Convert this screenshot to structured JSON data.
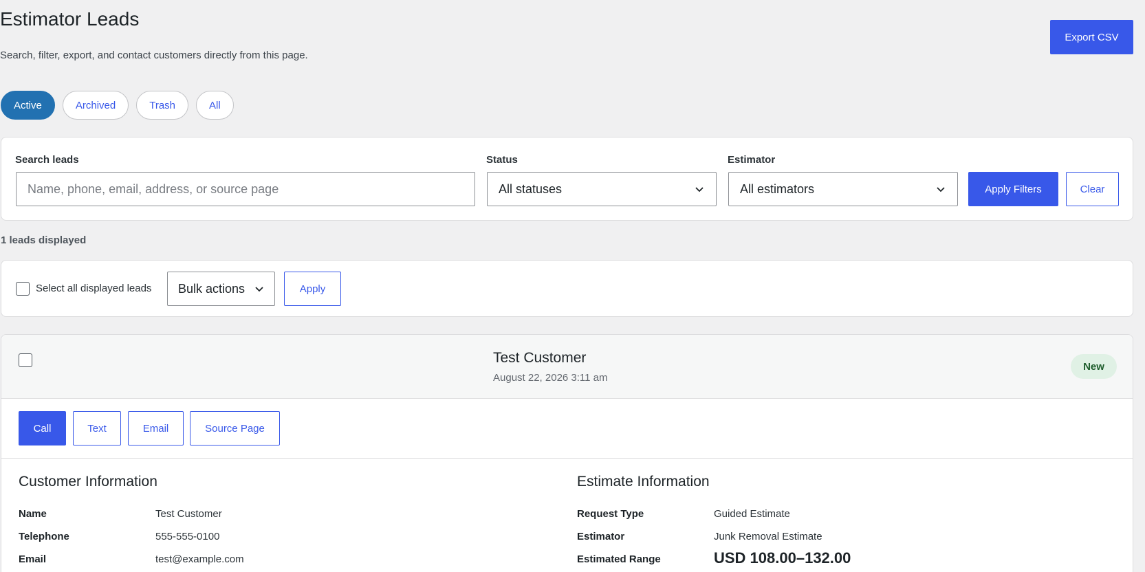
{
  "header": {
    "title": "Estimator Leads",
    "subtitle": "Search, filter, export, and contact customers directly from this page.",
    "export_label": "Export CSV"
  },
  "tabs": [
    {
      "label": "Active",
      "active": true
    },
    {
      "label": "Archived",
      "active": false
    },
    {
      "label": "Trash",
      "active": false
    },
    {
      "label": "All",
      "active": false
    }
  ],
  "filters": {
    "search_label": "Search leads",
    "search_placeholder": "Name, phone, email, address, or source page",
    "status_label": "Status",
    "status_value": "All statuses",
    "estimator_label": "Estimator",
    "estimator_value": "All estimators",
    "apply_label": "Apply Filters",
    "clear_label": "Clear"
  },
  "count_text": "1 leads displayed",
  "bulk": {
    "select_all_label": "Select all displayed leads",
    "select_value": "Bulk actions",
    "apply_label": "Apply"
  },
  "lead": {
    "name": "Test Customer",
    "date": "August 22, 2026 3:11 am",
    "status": "New",
    "actions": {
      "call": "Call",
      "text": "Text",
      "email": "Email",
      "source": "Source Page"
    },
    "customer": {
      "title": "Customer Information",
      "rows": [
        {
          "label": "Name",
          "value": "Test Customer"
        },
        {
          "label": "Telephone",
          "value": "555-555-0100"
        },
        {
          "label": "Email",
          "value": "test@example.com"
        }
      ]
    },
    "estimate": {
      "title": "Estimate Information",
      "rows": [
        {
          "label": "Request Type",
          "value": "Guided Estimate"
        },
        {
          "label": "Estimator",
          "value": "Junk Removal Estimate"
        },
        {
          "label": "Estimated Range",
          "value": "USD 108.00–132.00"
        }
      ]
    }
  },
  "colors": {
    "primary": "#3858e9",
    "tab_active": "#2271b1",
    "badge_bg": "#e0f1e5",
    "badge_text": "#1e5d2c"
  }
}
